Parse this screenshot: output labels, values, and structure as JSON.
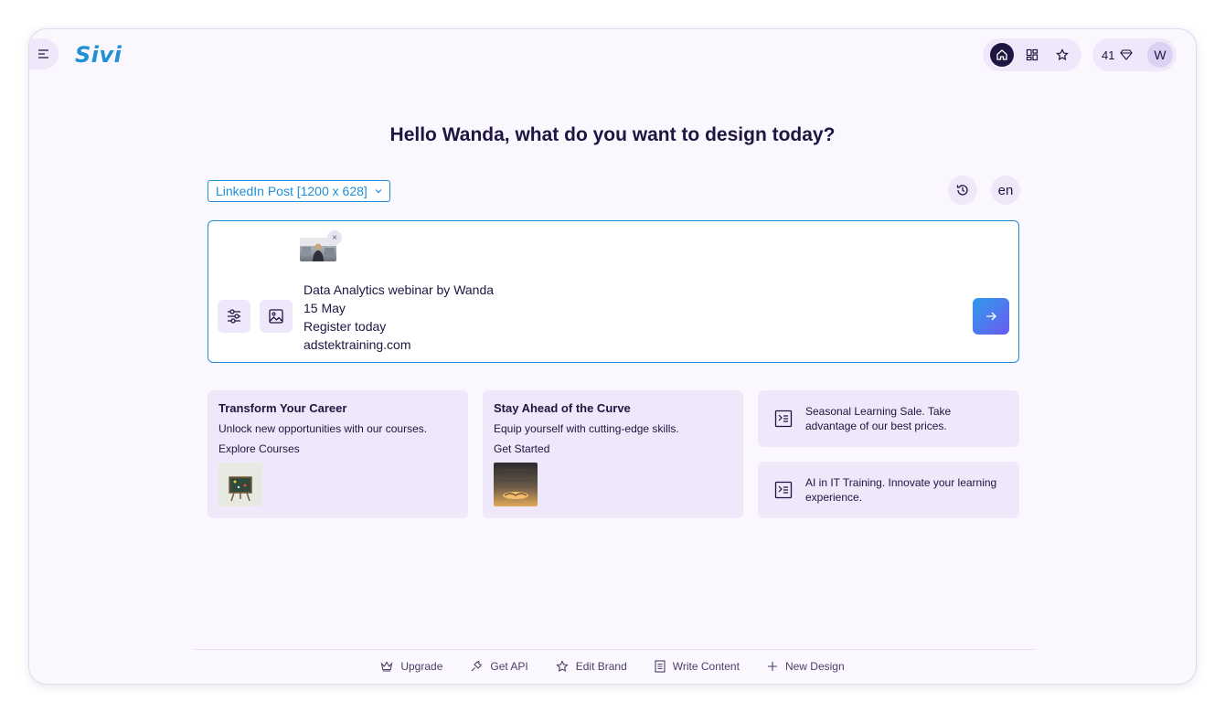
{
  "app": {
    "logo": "Sivi"
  },
  "header": {
    "credits": "41",
    "avatar_initial": "W"
  },
  "main": {
    "greeting": "Hello Wanda, what do you want to design today?",
    "format": "LinkedIn Post [1200 x 628]",
    "language": "en",
    "prompt_lines": [
      "Data Analytics webinar by Wanda",
      "15 May",
      "Register today",
      "adstektraining.com"
    ]
  },
  "suggestions": [
    {
      "title": "Transform Your Career",
      "line1": "Unlock new opportunities with our courses.",
      "line2": "Explore Courses"
    },
    {
      "title": "Stay Ahead of the Curve",
      "line1": "Equip yourself with cutting-edge skills.",
      "line2": "Get Started"
    }
  ],
  "quick_prompts": [
    {
      "text": "Seasonal Learning Sale. Take advantage of our best prices."
    },
    {
      "text": "AI in IT Training. Innovate your learning experience."
    }
  ],
  "footer": {
    "items": [
      {
        "label": "Upgrade",
        "icon": "crown-icon"
      },
      {
        "label": "Get API",
        "icon": "plug-icon"
      },
      {
        "label": "Edit Brand",
        "icon": "star-icon"
      },
      {
        "label": "Write Content",
        "icon": "document-icon"
      },
      {
        "label": "New Design",
        "icon": "plus-icon"
      }
    ]
  },
  "colors": {
    "accent": "#1f8fd6",
    "brand_dark": "#1e1540",
    "panel": "#efe7fa"
  }
}
